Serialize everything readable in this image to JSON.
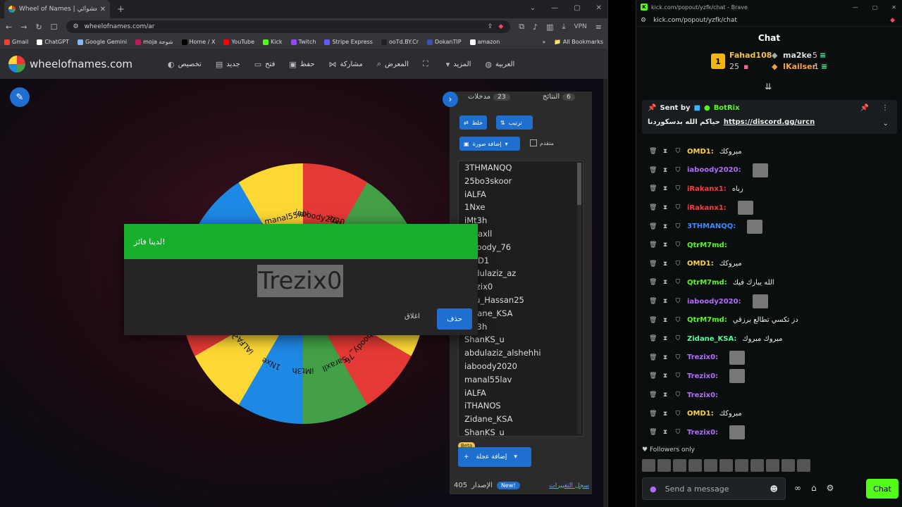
{
  "left_window": {
    "tab_title": "Wheel of Names | اسم العشوائي",
    "url": "wheelofnames.com/ar",
    "vpn_label": "VPN",
    "bookmarks": [
      {
        "label": "Gmail",
        "color": "#ea4335"
      },
      {
        "label": "ChatGPT",
        "color": "#ffffff"
      },
      {
        "label": "Google Gemini",
        "color": "#8ab4f8"
      },
      {
        "label": "moja شوجة",
        "color": "#c2185b"
      },
      {
        "label": "Home / X",
        "color": "#000000"
      },
      {
        "label": "YouTube",
        "color": "#ff0000"
      },
      {
        "label": "Kick",
        "color": "#53fc18"
      },
      {
        "label": "Twitch",
        "color": "#9146ff"
      },
      {
        "label": "Stripe Express",
        "color": "#635bff"
      },
      {
        "label": "ooTd.BY.Cr",
        "color": "#222222"
      },
      {
        "label": "DokanTIP",
        "color": "#3f51b5"
      },
      {
        "label": "amazon",
        "color": "#ffffff"
      }
    ],
    "all_bookmarks": "All Bookmarks"
  },
  "site": {
    "logo": "wheelofnames.com",
    "nav": [
      {
        "label": "تخصيص",
        "icon": "palette-icon"
      },
      {
        "label": "جديد",
        "icon": "file-icon"
      },
      {
        "label": "فتح",
        "icon": "folder-icon"
      },
      {
        "label": "حفظ",
        "icon": "save-icon"
      },
      {
        "label": "مشاركة",
        "icon": "share-icon"
      },
      {
        "label": "المعرض",
        "icon": "search-icon"
      },
      {
        "label": "",
        "icon": "fullscreen-icon"
      },
      {
        "label": "المزيد",
        "icon": "chevron-down-icon"
      },
      {
        "label": "العربية",
        "icon": "globe-icon"
      }
    ]
  },
  "wheel": {
    "labels": [
      "iaboody2020",
      "abdulaziz_alshehhi",
      "ShanKS_u",
      "iMt3h",
      "OMD1",
      "iaboody_76",
      "Saraxll",
      "iMt3h",
      "1Nxe",
      "iALFA",
      "25bo3skoor",
      "3THMANQQ",
      "iLai_89",
      "iALFA",
      "manal55lav"
    ]
  },
  "panel": {
    "tab_entries": "مدخلات",
    "entries_count": "23",
    "tab_results": "النتائج",
    "results_count": "6",
    "shuffle": "خلط",
    "sort": "ترتيب",
    "add_image": "إضافة صورة",
    "advanced": "متقدم",
    "entries": [
      "3THMANQQ",
      "25bo3skoor",
      "iALFA",
      "1Nxe",
      "iMt3h",
      "Saraxll",
      "iaboody_76",
      "OMD1",
      "abdulaziz_az",
      "Trezix0",
      "Abu_Hassan25",
      "Zidane_KSA",
      "iMt3h",
      "ShanKS_u",
      "abdulaziz_alshehhi",
      "iaboody2020",
      "manal55lav",
      "iALFA",
      "iTHANOS",
      "Zidane_KSA",
      "ShanKS_u"
    ],
    "beta": "Beta",
    "add_wheel": "إضافة عجلة",
    "version_label": "الإصدار",
    "version": "405",
    "new": "New!",
    "changelog": "سجل التغييرات"
  },
  "dialog": {
    "title": "لدينا فائز!",
    "winner": "Trezix0",
    "remove": "حذف",
    "close": "اغلاق"
  },
  "right_window": {
    "title": "kick.com/popout/yzfk/chat - Brave",
    "url": "kick.com/popout/yzfk/chat",
    "chat_title": "Chat",
    "leaderboard": [
      {
        "name": "Fahad108",
        "value": "25",
        "rank": "1"
      },
      {
        "name": "ma2ke",
        "value": "5"
      },
      {
        "name": "IKailser",
        "value": "1"
      }
    ],
    "pinned": {
      "sent_by_label": "Sent by",
      "sender": "BotRix",
      "text": "حياكم الله بدسكوردنا",
      "link": "https://discord.gg/urcn"
    },
    "messages": [
      {
        "user": "OMD1:",
        "text": "مبروكك",
        "color": "#ffd23f"
      },
      {
        "user": "iaboody2020:",
        "text": "",
        "color": "#b36bff",
        "thumb": true
      },
      {
        "user": "iRakanx1:",
        "text": "رباه",
        "color": "#ff3b3b"
      },
      {
        "user": "iRakanx1:",
        "text": "",
        "color": "#ff3b3b",
        "thumb": true
      },
      {
        "user": "3THMANQQ:",
        "text": "",
        "color": "#3b8bff",
        "thumb": true
      },
      {
        "user": "QtrM7md:",
        "text": "",
        "color": "#53fc18"
      },
      {
        "user": "OMD1:",
        "text": "مبروكك",
        "color": "#ffd23f"
      },
      {
        "user": "QtrM7md:",
        "text": "الله يبارك فيك",
        "color": "#53fc18"
      },
      {
        "user": "iaboody2020:",
        "text": "",
        "color": "#b36bff",
        "thumb": true
      },
      {
        "user": "QtrM7md:",
        "text": "دز تكسي تطالع برزقي",
        "color": "#53fc18"
      },
      {
        "user": "Zidane_KSA:",
        "text": "مبروك مبروك",
        "color": "#53fc9b"
      },
      {
        "user": "Trezix0:",
        "text": "",
        "color": "#b36bff",
        "thumb": true
      },
      {
        "user": "Trezix0:",
        "text": "",
        "color": "#b36bff",
        "thumb": true
      },
      {
        "user": "Trezix0:",
        "text": "",
        "color": "#b36bff"
      },
      {
        "user": "OMD1:",
        "text": "مبروكك",
        "color": "#ffd23f"
      },
      {
        "user": "Trezix0:",
        "text": "",
        "color": "#b36bff",
        "thumb": true
      }
    ],
    "followers_only": "Followers only",
    "composer_placeholder": "Send a message",
    "send": "Chat"
  }
}
